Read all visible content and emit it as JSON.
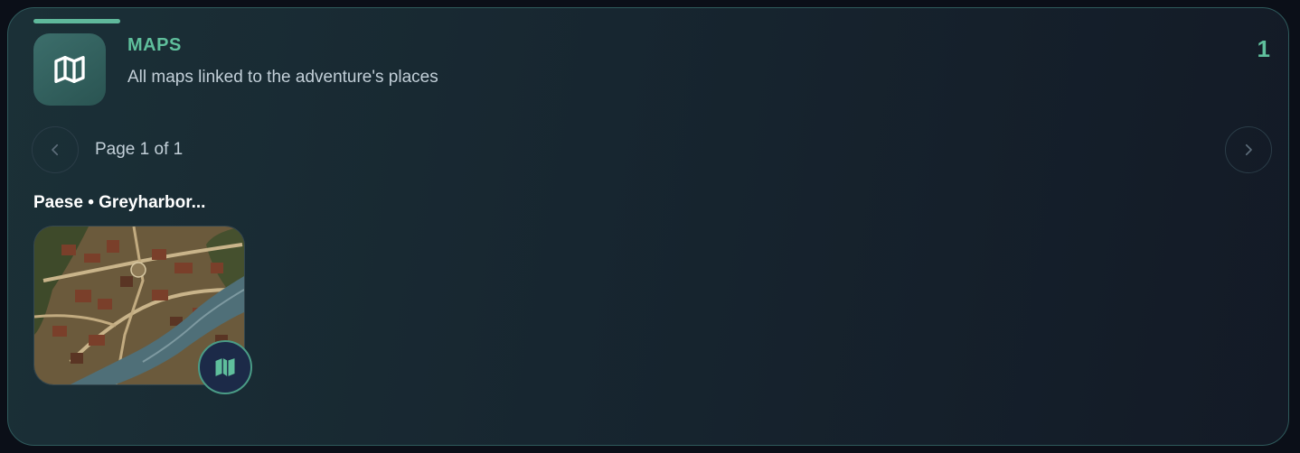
{
  "section": {
    "title": "MAPS",
    "subtitle": "All maps linked to the adventure's places",
    "count": "1",
    "header_icon": "map-icon",
    "accent_color": "#5fbf9c"
  },
  "pagination": {
    "label": "Page 1 of 1",
    "prev_icon": "chevron-left-icon",
    "next_icon": "chevron-right-icon"
  },
  "maps": [
    {
      "title": "Paese • Greyharbor...",
      "thumbnail": "town-map-thumbnail",
      "badge_icon": "map-icon"
    }
  ]
}
